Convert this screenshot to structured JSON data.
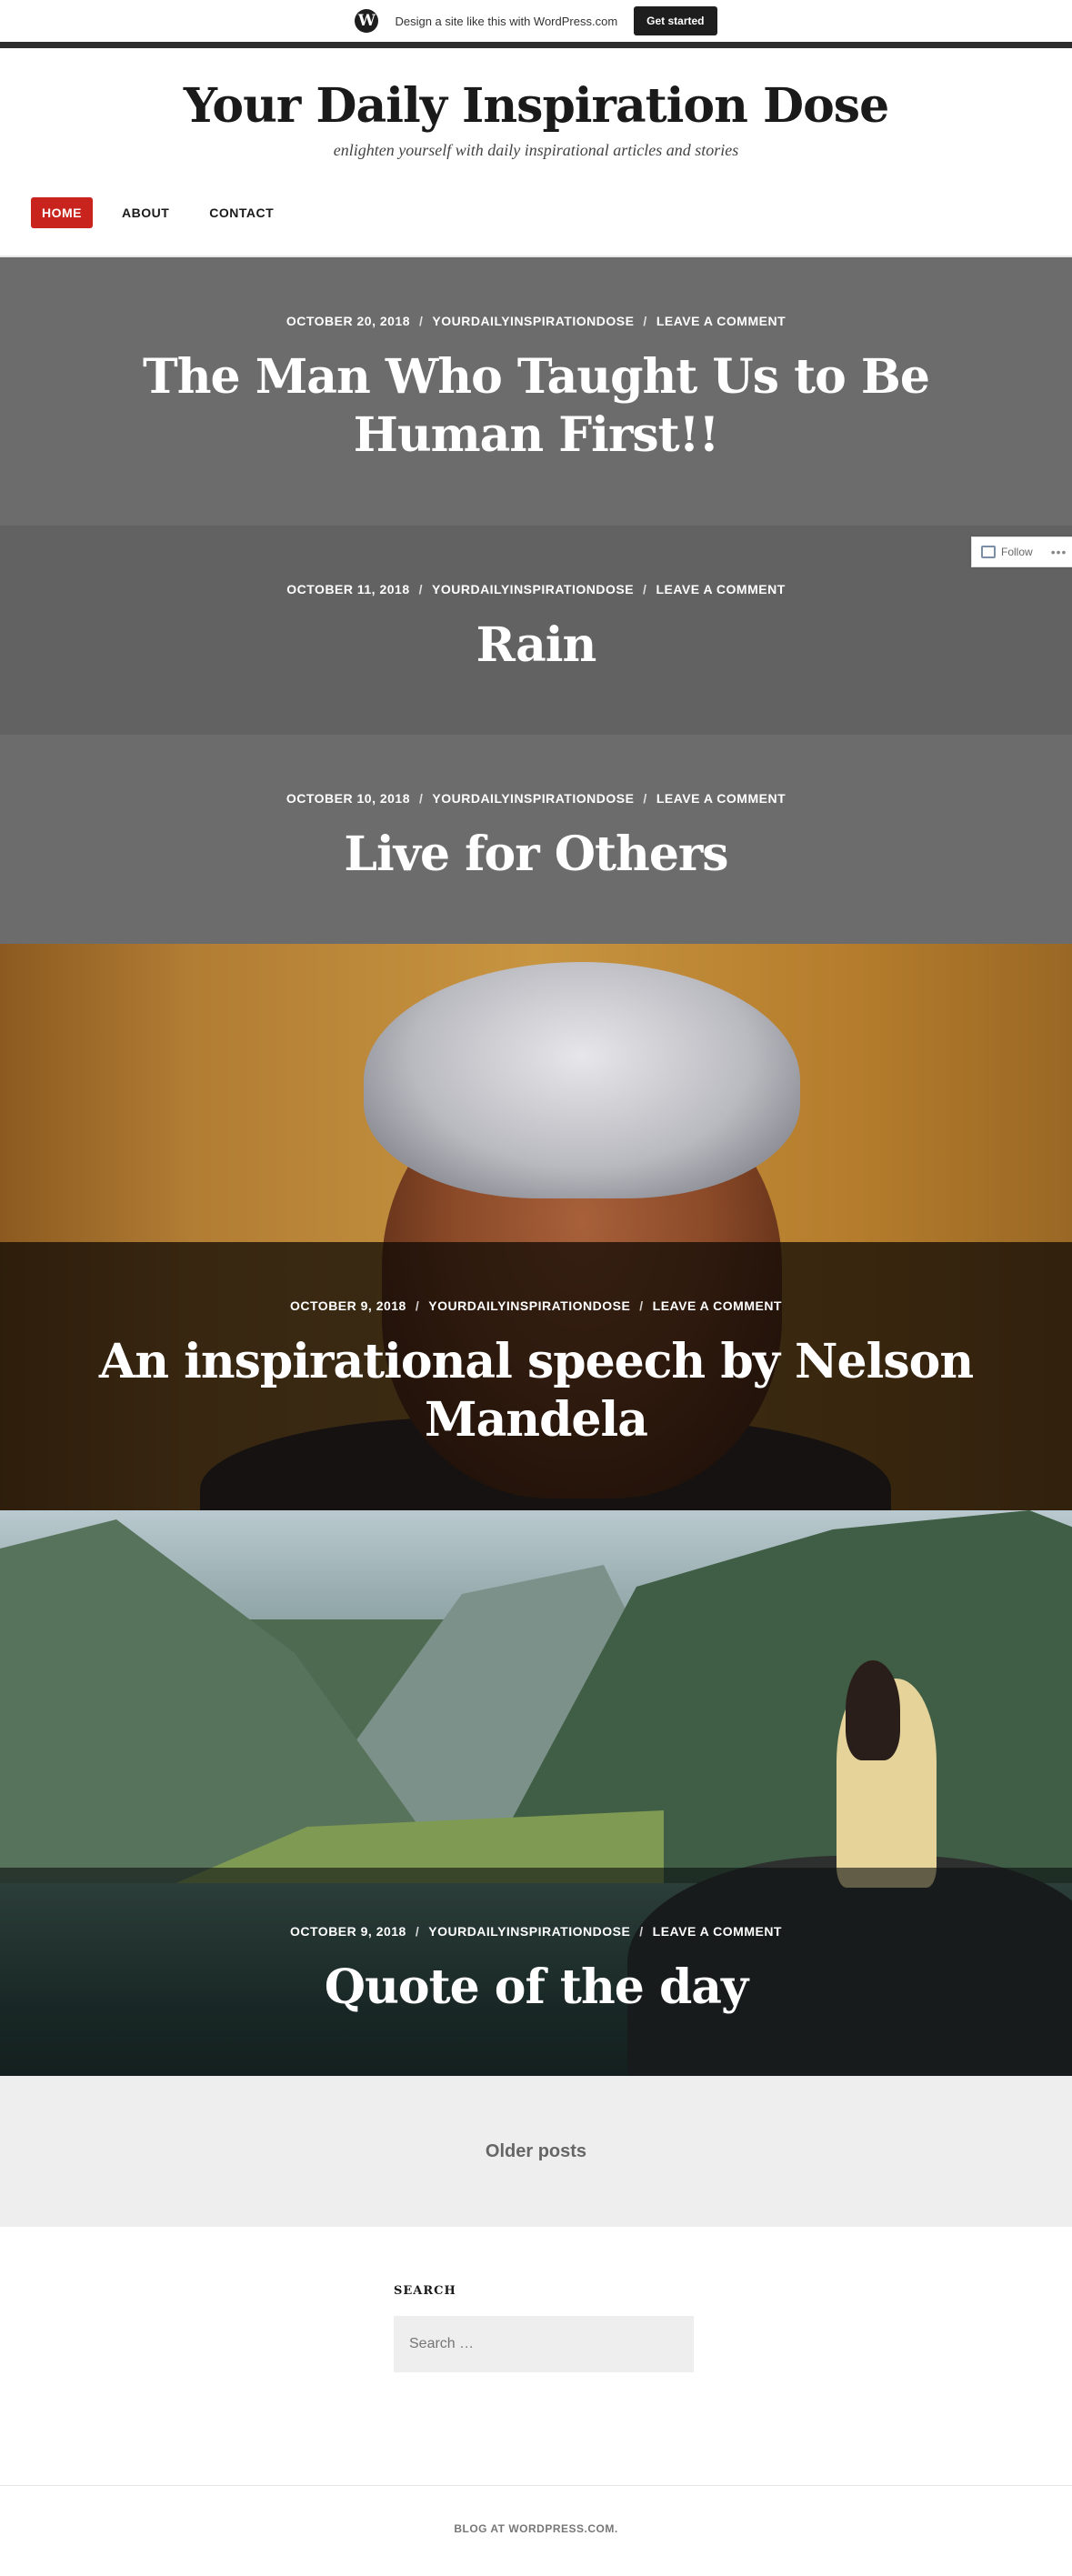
{
  "wpbar": {
    "text": "Design a site like this with WordPress.com",
    "button": "Get started",
    "logo": "W"
  },
  "site": {
    "title": "Your Daily Inspiration Dose",
    "tagline": "enlighten yourself with daily inspirational articles and stories"
  },
  "nav": {
    "items": [
      "HOME",
      "ABOUT",
      "CONTACT"
    ],
    "active": "HOME"
  },
  "posts": [
    {
      "date": "OCTOBER 20, 2018",
      "author": "YOURDAILYINSPIRATIONDOSE",
      "comment": "LEAVE A COMMENT",
      "title": "The Man Who Taught Us to Be Human First!!"
    },
    {
      "date": "OCTOBER 11, 2018",
      "author": "YOURDAILYINSPIRATIONDOSE",
      "comment": "LEAVE A COMMENT",
      "title": "Rain"
    },
    {
      "date": "OCTOBER 10, 2018",
      "author": "YOURDAILYINSPIRATIONDOSE",
      "comment": "LEAVE A COMMENT",
      "title": "Live for Others"
    },
    {
      "date": "OCTOBER 9, 2018",
      "author": "YOURDAILYINSPIRATIONDOSE",
      "comment": "LEAVE A COMMENT",
      "title": "An inspirational speech by Nelson Mandela"
    },
    {
      "date": "OCTOBER 9, 2018",
      "author": "YOURDAILYINSPIRATIONDOSE",
      "comment": "LEAVE A COMMENT",
      "title": "Quote of the day"
    }
  ],
  "meta_separator": "/",
  "follow": {
    "label": "Follow",
    "more": "•••"
  },
  "pagination": {
    "older": "Older posts"
  },
  "search": {
    "title": "SEARCH",
    "placeholder": "Search …"
  },
  "footer": {
    "text": "BLOG AT WORDPRESS.COM."
  },
  "colors": {
    "accent": "#c9231d",
    "text": "#1a1a1a",
    "post_bg": "#6c6c6c"
  }
}
